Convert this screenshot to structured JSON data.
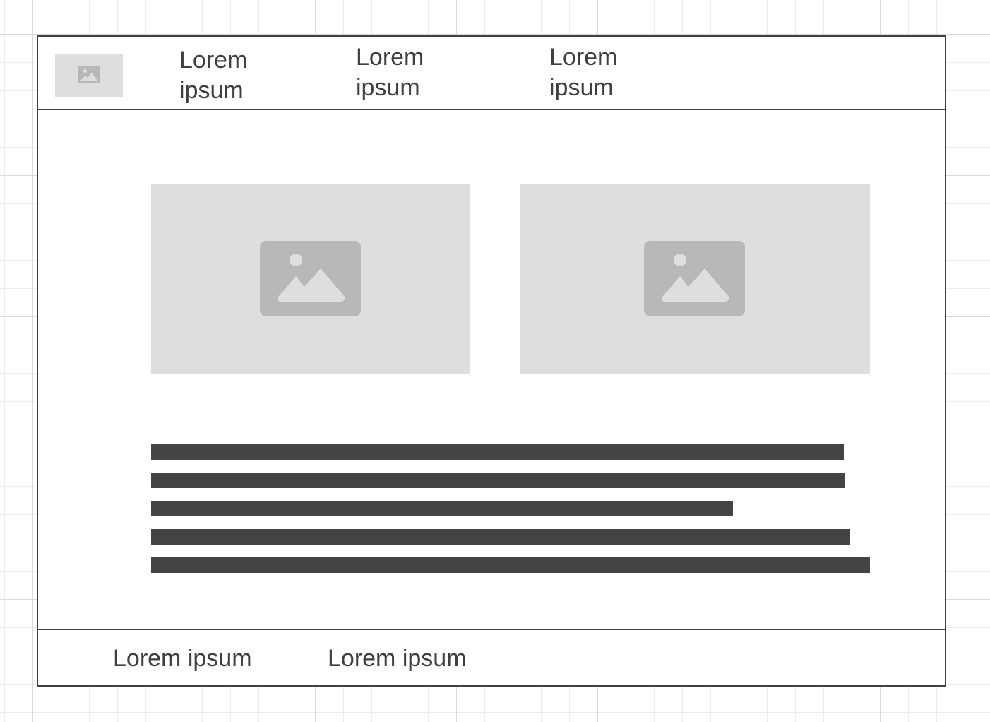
{
  "header": {
    "logo_icon": "image-placeholder-icon",
    "nav_items": [
      {
        "label": "Lorem ipsum"
      },
      {
        "label": "Lorem ipsum"
      },
      {
        "label": "Lorem ipsum"
      }
    ]
  },
  "main": {
    "images": [
      {
        "icon": "image-placeholder-icon"
      },
      {
        "icon": "image-placeholder-icon"
      }
    ],
    "text_block": {
      "line_count": 5
    }
  },
  "footer": {
    "links": [
      {
        "label": "Lorem ipsum"
      },
      {
        "label": "Lorem ipsum"
      }
    ]
  },
  "colors": {
    "frame_border": "#404040",
    "placeholder_fill": "#dedede",
    "placeholder_icon": "#b8b8b8",
    "text_line": "#444444",
    "text": "#3f3f3f",
    "grid_major": "#d9d9d9",
    "grid_minor": "#ececec"
  }
}
